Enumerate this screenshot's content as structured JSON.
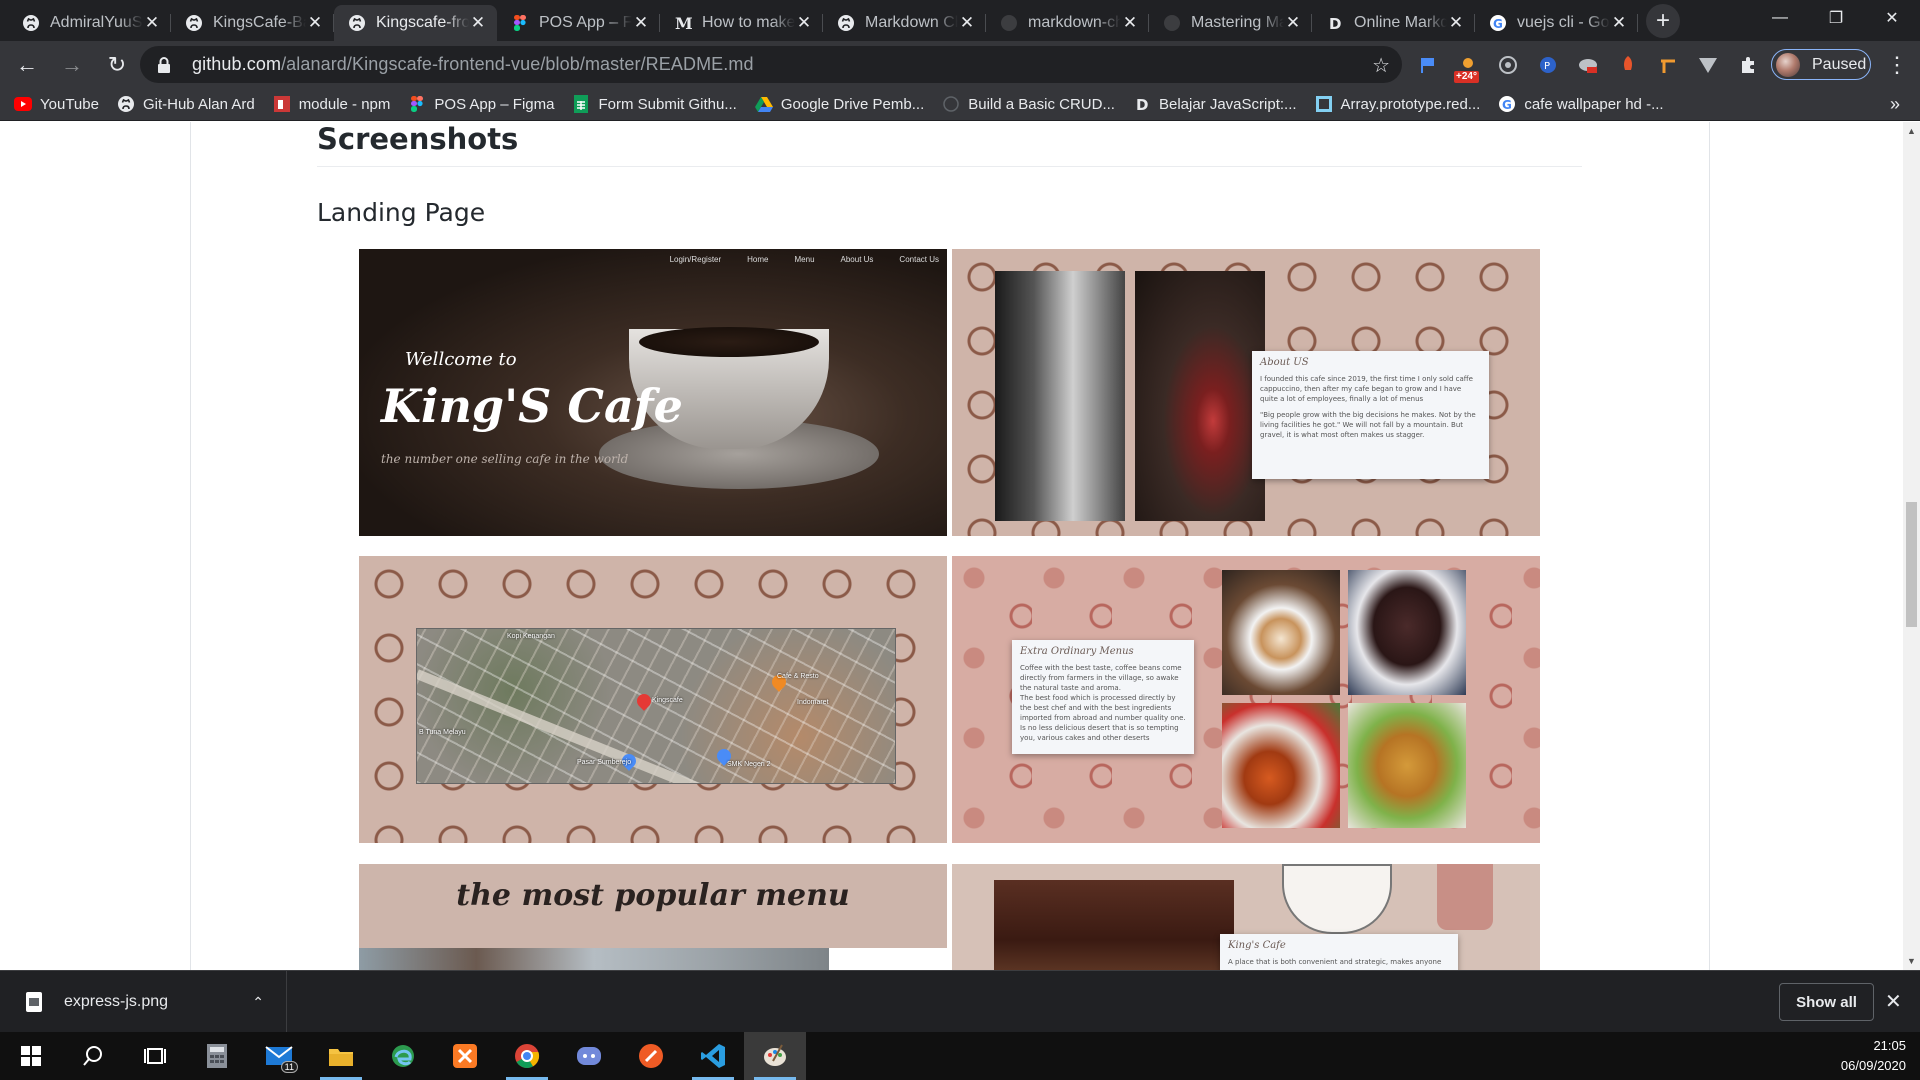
{
  "tabs": [
    {
      "title": "AdmiralYuuSyu",
      "icon": "github"
    },
    {
      "title": "KingsCafe-Backend",
      "icon": "github"
    },
    {
      "title": "Kingscafe-frontend",
      "icon": "github",
      "active": true
    },
    {
      "title": "POS App – Figma",
      "icon": "figma"
    },
    {
      "title": "How to make",
      "icon": "medium"
    },
    {
      "title": "Markdown Cheatsheet",
      "icon": "github"
    },
    {
      "title": "markdown-cheatsheet",
      "icon": "github-dim"
    },
    {
      "title": "Mastering Markdown",
      "icon": "github-dim"
    },
    {
      "title": "Online Markdown",
      "icon": "d"
    },
    {
      "title": "vuejs cli - Google",
      "icon": "google"
    }
  ],
  "toolbar": {
    "url_host": "github.com",
    "url_path": "/alanard/Kingscafe-frontend-vue/blob/master/README.md",
    "weather_badge": "+24°",
    "profile_label": "Paused"
  },
  "bookmarks": [
    {
      "label": "YouTube",
      "icon": "youtube"
    },
    {
      "label": "Git-Hub Alan Ard",
      "icon": "github"
    },
    {
      "label": "module - npm",
      "icon": "npm"
    },
    {
      "label": "POS App – Figma",
      "icon": "figma"
    },
    {
      "label": "Form Submit Githu...",
      "icon": "sheets"
    },
    {
      "label": "Google Drive Pemb...",
      "icon": "drive"
    },
    {
      "label": "Build a Basic CRUD...",
      "icon": "blank"
    },
    {
      "label": "Belajar JavaScript:...",
      "icon": "d"
    },
    {
      "label": "Array.prototype.red...",
      "icon": "mdn"
    },
    {
      "label": "cafe wallpaper hd -...",
      "icon": "google"
    }
  ],
  "readme": {
    "h2": "Screenshots",
    "h3": "Landing Page"
  },
  "shots": {
    "s1": {
      "nav": [
        "Login/Register",
        "Home",
        "Menu",
        "About Us",
        "Contact Us"
      ],
      "welcome": "Wellcome to",
      "title": "King'S Cafe",
      "tagline": "the number one selling cafe in the world"
    },
    "s2": {
      "card_title": "About US",
      "p1": "I founded this cafe since 2019, the first time I only sold caffe cappuccino, then after my cafe began to grow and I have quite a lot of employees, finally a lot of menus",
      "p2": "\"Big people grow with the big decisions he makes. Not by the living facilities he got.\" We will not fall by a mountain. But gravel, it is what most often makes us stagger."
    },
    "s3": {
      "labels": [
        "Kopi Kenangan",
        "Cafe & Resto",
        "Kingscafe",
        "Indomaret",
        "Pasar Sumberejo",
        "SMK Negeri 2",
        "B Tuna Melayu"
      ]
    },
    "s4": {
      "card_title": "Extra Ordinary Menus",
      "p1": "Coffee with the best taste, coffee beans come directly from farmers in the village, so awake the natural taste and aroma.",
      "p2": "The best food which is processed directly by the best chef and with the best ingredients imported from abroad and number quality one.",
      "p3": "Is no less delicious desert that is so tempting you, various cakes and other deserts"
    },
    "s5": {
      "title": "the most popular menu"
    },
    "s6": {
      "card_title": "King's Cafe",
      "text": "A place that is both convenient and strategic, makes anyone"
    }
  },
  "download": {
    "filename": "express-js.png",
    "show_all": "Show all"
  },
  "taskbar": {
    "mail_badge": "11",
    "time": "21:05",
    "date": "06/09/2020"
  }
}
